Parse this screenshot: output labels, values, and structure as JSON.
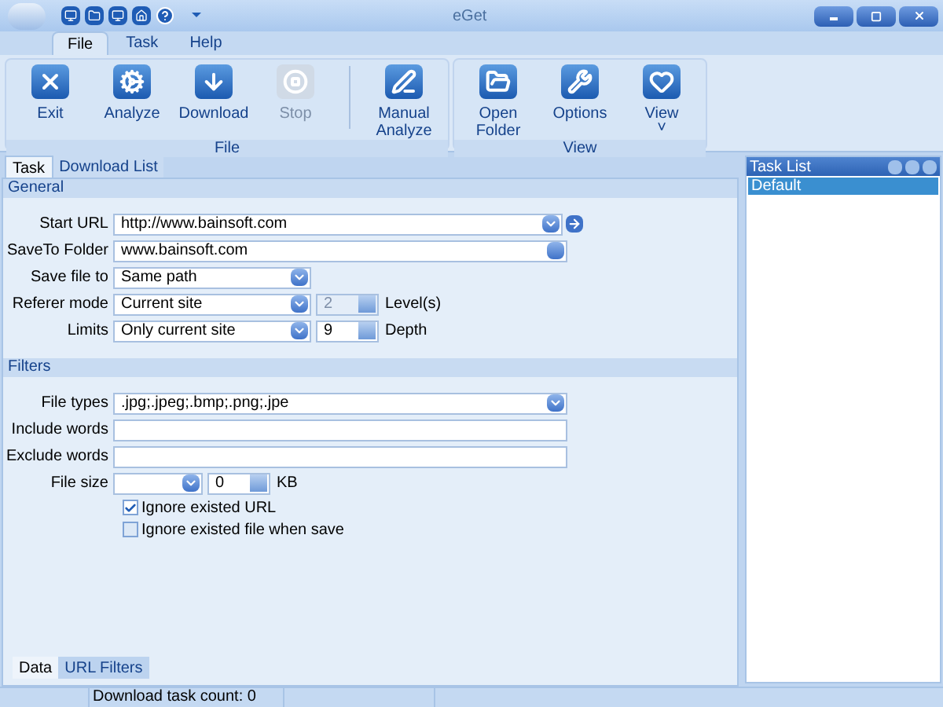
{
  "window": {
    "title": "eGet"
  },
  "ribbon_tabs": [
    {
      "label": "File",
      "selected": true
    },
    {
      "label": "Task",
      "selected": false
    },
    {
      "label": "Help",
      "selected": false
    }
  ],
  "ribbon_groups": [
    {
      "label": "File",
      "buttons": [
        {
          "label": "Exit",
          "disabled": false
        },
        {
          "label": "Analyze",
          "disabled": false
        },
        {
          "label": "Download",
          "disabled": false
        },
        {
          "label": "Stop",
          "disabled": true
        },
        {
          "label": "Manual Analyze",
          "disabled": false,
          "separated": true
        }
      ]
    },
    {
      "label": "View",
      "buttons": [
        {
          "label": "Open Folder",
          "disabled": false
        },
        {
          "label": "Options",
          "disabled": false
        },
        {
          "label": "View",
          "disabled": false,
          "caret": "˅"
        }
      ]
    }
  ],
  "task_tabs": [
    {
      "label": "Task",
      "selected": true
    },
    {
      "label": "Download List",
      "selected": false
    }
  ],
  "general": {
    "title": "General",
    "rows": [
      {
        "kind": "url",
        "label": "Start URL",
        "value": "http://www.bainsoft.com"
      },
      {
        "kind": "folder",
        "label": "SaveTo Folder",
        "value": "www.bainsoft.com"
      },
      {
        "kind": "combo",
        "label": "Save file to",
        "value": "Same path"
      },
      {
        "kind": "combo_spin",
        "label": "Referer mode",
        "value": "Current site",
        "spin": {
          "value": "2",
          "disabled": true,
          "unit": "Level(s)"
        }
      },
      {
        "kind": "combo_spin",
        "label": "Limits",
        "value": "Only current site",
        "spin": {
          "value": "9",
          "disabled": false,
          "unit": "Depth"
        }
      }
    ]
  },
  "filters": {
    "title": "Filters",
    "rows": [
      {
        "kind": "wide_combo",
        "label": "File types",
        "value": ".jpg;.jpeg;.bmp;.png;.jpe"
      },
      {
        "kind": "text",
        "label": "Include words"
      },
      {
        "kind": "text",
        "label": "Exclude words"
      },
      {
        "kind": "size",
        "label": "File size",
        "spin": {
          "value": "0",
          "disabled": false,
          "unit": "KB"
        }
      }
    ],
    "checkboxes": [
      {
        "label": "Ignore existed URL",
        "checked": true
      },
      {
        "label": "Ignore existed file when save",
        "checked": false
      }
    ]
  },
  "bottom_tabs": [
    {
      "label": "Data",
      "selected": true
    },
    {
      "label": "URL Filters",
      "selected": false
    }
  ],
  "task_list": {
    "title": "Task List",
    "items": [
      {
        "label": "Default",
        "selected": true
      }
    ]
  },
  "status_bar": {
    "text": "Download task count: 0"
  }
}
